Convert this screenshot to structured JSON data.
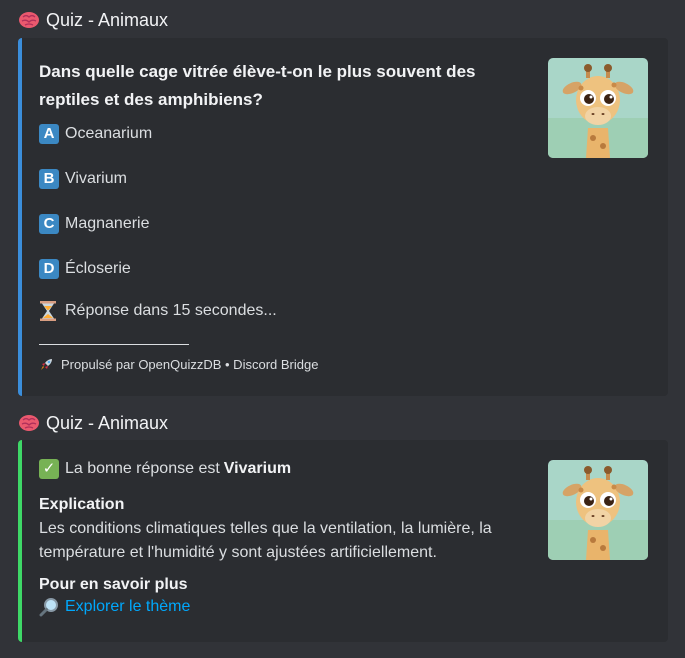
{
  "messages": [
    {
      "header": {
        "title": "Quiz - Animaux",
        "icon": "brain-icon"
      },
      "embed": {
        "accent_color": "#3b8edb",
        "question": "Dans quelle cage vitrée élève-t-on le plus souvent des reptiles et des amphibiens?",
        "options": [
          {
            "letter": "A",
            "text": "Oceanarium"
          },
          {
            "letter": "B",
            "text": "Vivarium"
          },
          {
            "letter": "C",
            "text": "Magnanerie"
          },
          {
            "letter": "D",
            "text": "Écloserie"
          }
        ],
        "timer_text": "Réponse dans 15 secondes...",
        "timer_icon": "hourglass-icon",
        "footer_text": "Propulsé par OpenQuizzDB • Discord Bridge",
        "footer_icon": "rocket-icon",
        "thumbnail": "giraffe-image"
      }
    },
    {
      "header": {
        "title": "Quiz - Animaux",
        "icon": "brain-icon"
      },
      "embed": {
        "accent_color": "#3ed867",
        "answer_prefix": "La bonne réponse est",
        "answer_value": "Vivarium",
        "answer_icon": "check-mark-icon",
        "explanation_title": "Explication",
        "explanation_text": "Les conditions climatiques telles que la ventilation, la lumière, la température et l'humidité y sont ajustées artificiellement.",
        "more_title": "Pour en savoir plus",
        "more_link": "Explorer le thème",
        "more_icon": "magnifier-icon",
        "thumbnail": "giraffe-image"
      }
    }
  ]
}
